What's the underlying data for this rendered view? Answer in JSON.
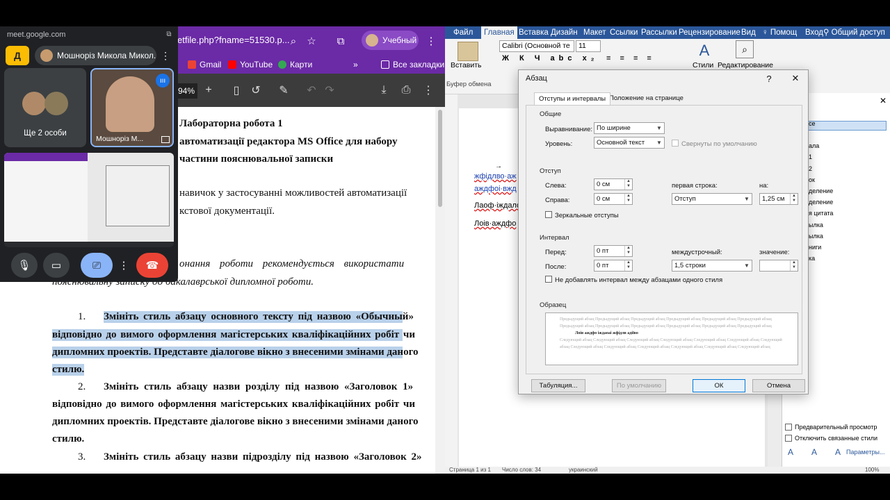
{
  "chrome": {
    "address": "etfile.php?fname=51530.p...",
    "profile_label": "Учебный",
    "bookmarks": [
      "Gmail",
      "YouTube",
      "Карти",
      "Все закладки"
    ],
    "zoom": "94%"
  },
  "pdf_doc": {
    "title1": "Лабораторна робота 1",
    "title2": "автоматизації редактора MS Office для набору",
    "title3": "частини пояснювальної записки",
    "aim1": "навичок у застосуванні можливостей автоматизації",
    "aim2": "кстової документації.",
    "note1": "онання роботи рекомендується використати",
    "note2": "пояснювальну записку до бакалаврської дипломної роботи.",
    "item1_num": "1.",
    "item1_l1": "Змініть стиль абзацу основного тексту під назвою «Обычный»",
    "item1_l2": "відповідно до вимого оформлення магістерських кваліфікаційних робіт чи",
    "item1_l3": "дипломних проектів. Представте діалогове вікно з внесеними змінами даного",
    "item1_l4": "стилю.",
    "item2_num": "2.",
    "item2_l1": "Змініть стиль абзацу назви розділу під назвою «Заголовок 1»",
    "item2_l2": "відповідно до вимого оформлення магістерських кваліфікаційних робіт чи",
    "item2_l3": "дипломних проектів. Представте діалогове вікно з внесеними змінами даного",
    "item2_l4": "стилю.",
    "item3_num": "3.",
    "item3_l1": "Змініть стиль абзацу назви підрозділу під назвою «Заголовок 2»"
  },
  "meet": {
    "url": "meet.google.com",
    "logo": "Д",
    "presenter": "Мошноріз Микола Микол...",
    "others_label": "Ще 2 особи",
    "tile_name": "Мошноріз М..."
  },
  "word": {
    "menu": [
      "Файл",
      "Главная",
      "Вставка",
      "Дизайн",
      "Макет",
      "Ссылки",
      "Рассылки",
      "Рецензирование",
      "Вид",
      "Помощ",
      "Вход",
      "Общий доступ"
    ],
    "font": "Calibri (Основной те",
    "size": "11",
    "paste_label": "Вставить",
    "clipboard_label": "Буфер обмена",
    "styles_label": "Стили",
    "edit_label": "Редактирование",
    "doc_line1": "жфідлво·аж",
    "doc_line2": "аждфоі·вжд",
    "doc_line3": "Лаоф·іждало",
    "doc_line4": "Лоів·аждфо",
    "styles_items": [
      "се",
      "ала",
      "1",
      "2",
      "ок",
      "деление",
      "деление",
      "я цитата",
      "ылка",
      "ылка",
      "ниги",
      "ка"
    ],
    "opt_preview": "Предварительный просмотр",
    "opt_linked": "Отключить связанные стили",
    "params": "Параметры...",
    "status_page": "Страница 1 из 1",
    "status_words": "Число слов: 34",
    "status_lang": "украинский",
    "status_zoom": "100%"
  },
  "dialog": {
    "title": "Абзац",
    "help": "?",
    "tab1": "Отступы и интервалы",
    "tab2": "Положение на странице",
    "general": "Общие",
    "align_label": "Выравнивание:",
    "align_value": "По ширине",
    "level_label": "Уровень:",
    "level_value": "Основной текст",
    "collapsed": "Свернуты по умолчанию",
    "indent": "Отступ",
    "left_label": "Слева:",
    "left_value": "0 см",
    "right_label": "Справа:",
    "right_value": "0 см",
    "first_label": "первая строка:",
    "first_value": "Отступ",
    "by_label": "на:",
    "by_value": "1,25 см",
    "mirror": "Зеркальные отступы",
    "spacing": "Интервал",
    "before_label": "Перед:",
    "before_value": "0 пт",
    "after_label": "После:",
    "after_value": "0 пт",
    "line_label": "междустрочный:",
    "line_value": "1,5 строки",
    "at_label": "значение:",
    "no_space": "Не добавлять интервал между абзацами одного стиля",
    "sample": "Образец",
    "preview_prev": "Предыдущий абзац Предыдущий абзац Предыдущий абзац Предыдущий абзац Предыдущий абзац Предыдущий абзац Предыдущий абзац Предыдущий абзац Предыдущий абзац Предыдущий абзац Предыдущий абзац Предыдущий абзац",
    "preview_cur": "Лоів аждфо іждаоаі жфідлв адіїво",
    "preview_next": "Следующий абзац Следующий абзац Следующий абзац Следующий абзац Следующий абзац Следующий абзац Следующий абзац Следующий абзац Следующий абзац Следующий абзац Следующий абзац Следующий абзац Следующий абзац",
    "tabs_btn": "Табуляция...",
    "default_btn": "По умолчанию",
    "ok": "ОК",
    "cancel": "Отмена"
  }
}
